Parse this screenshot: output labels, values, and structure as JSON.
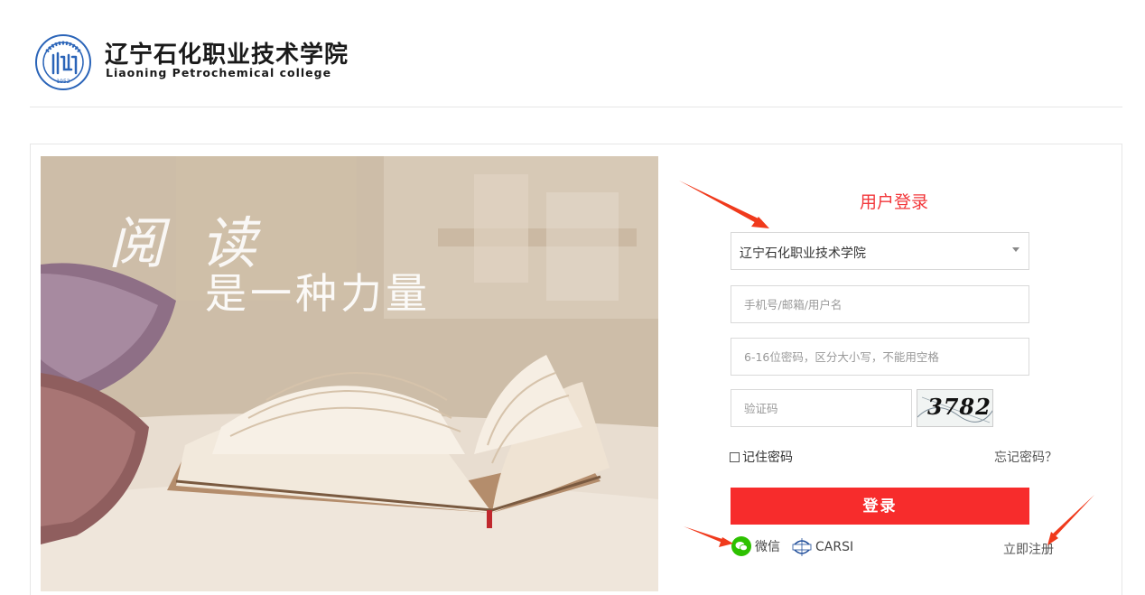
{
  "header": {
    "school_name_cn": "辽宁石化职业技术学院",
    "school_name_en": "Liaoning Petrochemical college",
    "emblem_text": "1952"
  },
  "hero": {
    "title": "阅 读",
    "subtitle": "是一种力量"
  },
  "login": {
    "title": "用户登录",
    "school_select": {
      "selected": "辽宁石化职业技术学院"
    },
    "username": {
      "placeholder": "手机号/邮箱/用户名",
      "value": ""
    },
    "password": {
      "placeholder": "6-16位密码，区分大小写，不能用空格",
      "value": ""
    },
    "captcha": {
      "placeholder": "验证码",
      "value": "",
      "image_text": "3782"
    },
    "remember_label": "记住密码",
    "forgot_label": "忘记密码？",
    "submit_label": "登录",
    "alt_login": [
      {
        "name": "wechat",
        "label": "微信",
        "icon": "wechat-icon",
        "color": "#2dc100"
      },
      {
        "name": "carsi",
        "label": "CARSI",
        "icon": "carsi-icon"
      }
    ],
    "register_label": "立即注册"
  },
  "colors": {
    "accent_red": "#f2373a",
    "button_red": "#f72c2c",
    "annotation_arrow": "#f03a1c"
  }
}
